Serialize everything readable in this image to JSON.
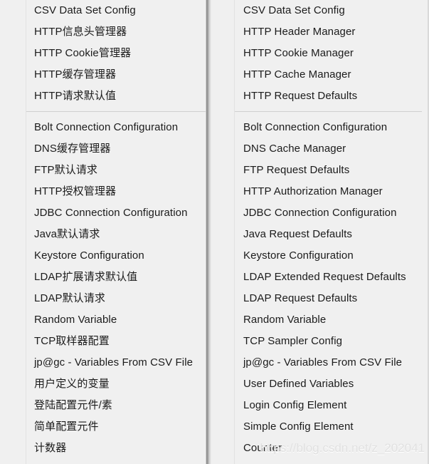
{
  "window": {
    "background_color": "#f0f0f0",
    "text_color": "#1b1b1b",
    "separator_color": "#cfcfcf",
    "divider_color": "#8d8d8d"
  },
  "menus": [
    {
      "name": "config-element-menu-chinese",
      "language": "zh-CN",
      "groups": [
        {
          "items": [
            "CSV Data Set Config",
            "HTTP信息头管理器",
            "HTTP Cookie管理器",
            "HTTP缓存管理器",
            "HTTP请求默认值"
          ]
        },
        {
          "items": [
            "Bolt Connection Configuration",
            "DNS缓存管理器",
            "FTP默认请求",
            "HTTP授权管理器",
            "JDBC Connection Configuration",
            "Java默认请求",
            "Keystore Configuration",
            "LDAP扩展请求默认值",
            "LDAP默认请求",
            "Random Variable",
            "TCP取样器配置",
            "jp@gc - Variables From CSV File",
            "用户定义的变量",
            "登陆配置元件/素",
            "简单配置元件",
            "计数器"
          ]
        }
      ]
    },
    {
      "name": "config-element-menu-english",
      "language": "en-US",
      "groups": [
        {
          "items": [
            "CSV Data Set Config",
            "HTTP Header Manager",
            "HTTP Cookie Manager",
            "HTTP Cache Manager",
            "HTTP Request Defaults"
          ]
        },
        {
          "items": [
            "Bolt Connection Configuration",
            "DNS Cache Manager",
            "FTP Request Defaults",
            "HTTP Authorization Manager",
            "JDBC Connection Configuration",
            "Java Request Defaults",
            "Keystore Configuration",
            "LDAP Extended Request Defaults",
            "LDAP Request Defaults",
            "Random Variable",
            "TCP Sampler Config",
            "jp@gc - Variables From CSV File",
            "User Defined Variables",
            "Login Config Element",
            "Simple Config Element",
            "Counter"
          ]
        }
      ]
    }
  ],
  "watermark": {
    "text": "https://blog.csdn.net/z_202041"
  }
}
